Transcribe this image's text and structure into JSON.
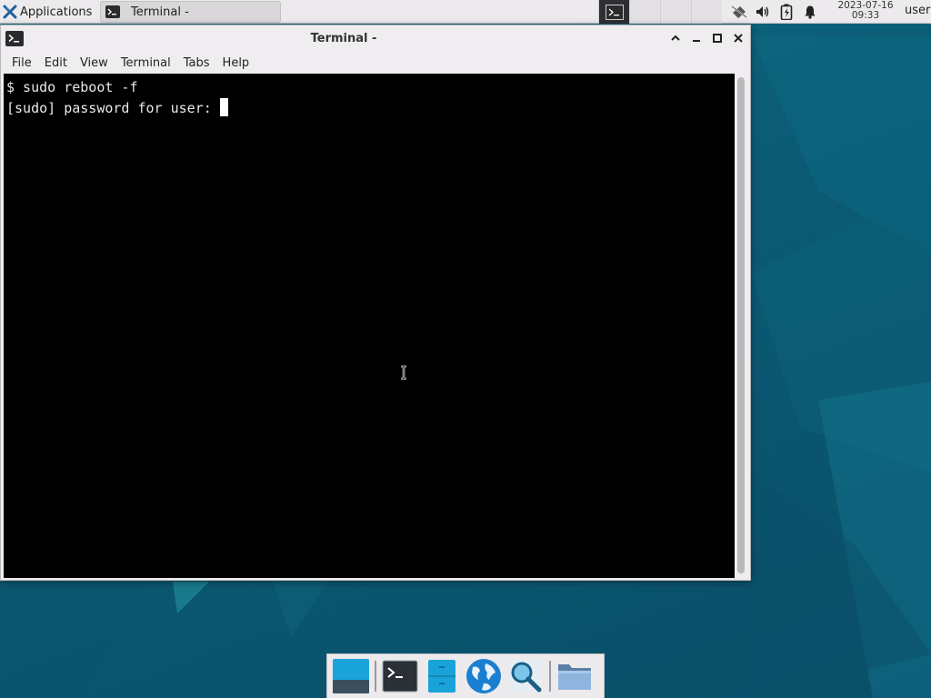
{
  "top_panel": {
    "apps_menu_label": "Applications",
    "task_button_label": "Terminal -",
    "clock_date": "2023-07-16",
    "clock_time": "09:33",
    "user_label": "user",
    "tray_icons": [
      "network-offline-icon",
      "volume-icon",
      "battery-icon",
      "notification-bell-icon"
    ]
  },
  "window": {
    "title": "Terminal -",
    "menu": [
      "File",
      "Edit",
      "View",
      "Terminal",
      "Tabs",
      "Help"
    ]
  },
  "terminal": {
    "lines": [
      "$ sudo reboot -f",
      "[sudo] password for user: "
    ]
  },
  "dock": {
    "items": [
      "show-desktop-icon",
      "terminal-icon",
      "file-manager-icon",
      "web-browser-icon",
      "app-finder-icon",
      "folder-icon"
    ]
  },
  "colors": {
    "desktop": "#0b5a74",
    "terminal_bg": "#000000",
    "terminal_fg": "#e8e8e8",
    "panel_bg": "#eceaec"
  }
}
